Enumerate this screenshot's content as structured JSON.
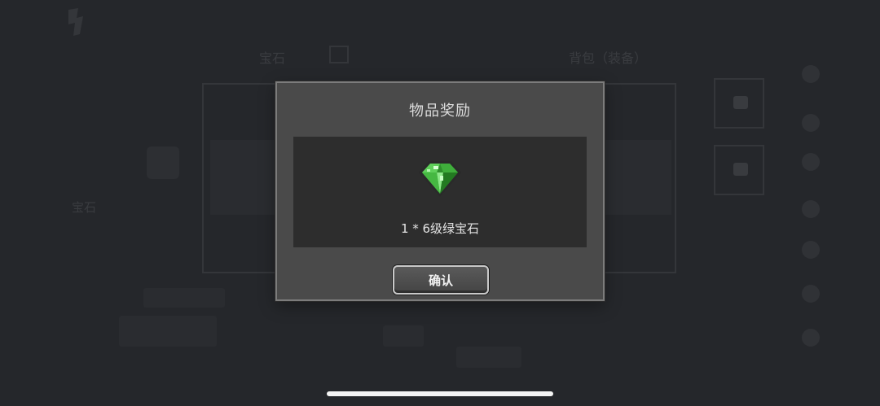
{
  "background": {
    "logo_text": "",
    "top_nav": [
      "",
      "",
      "",
      "",
      "",
      ""
    ],
    "tab_gem": "宝石",
    "tab_bag": "背包（装备）",
    "side_label": "宝石",
    "side_buttons": [
      "",
      "",
      "",
      "",
      "",
      "",
      ""
    ]
  },
  "modal": {
    "title": "物品奖励",
    "reward": {
      "icon": "green-gem-icon",
      "text": "1 * 6级绿宝石"
    },
    "confirm_label": "确认"
  },
  "colors": {
    "modal_bg": "#4a4a4a",
    "modal_border": "#7c7c7c",
    "reward_box_bg": "#2d2d2d",
    "gem_green": "#3fae3b"
  }
}
